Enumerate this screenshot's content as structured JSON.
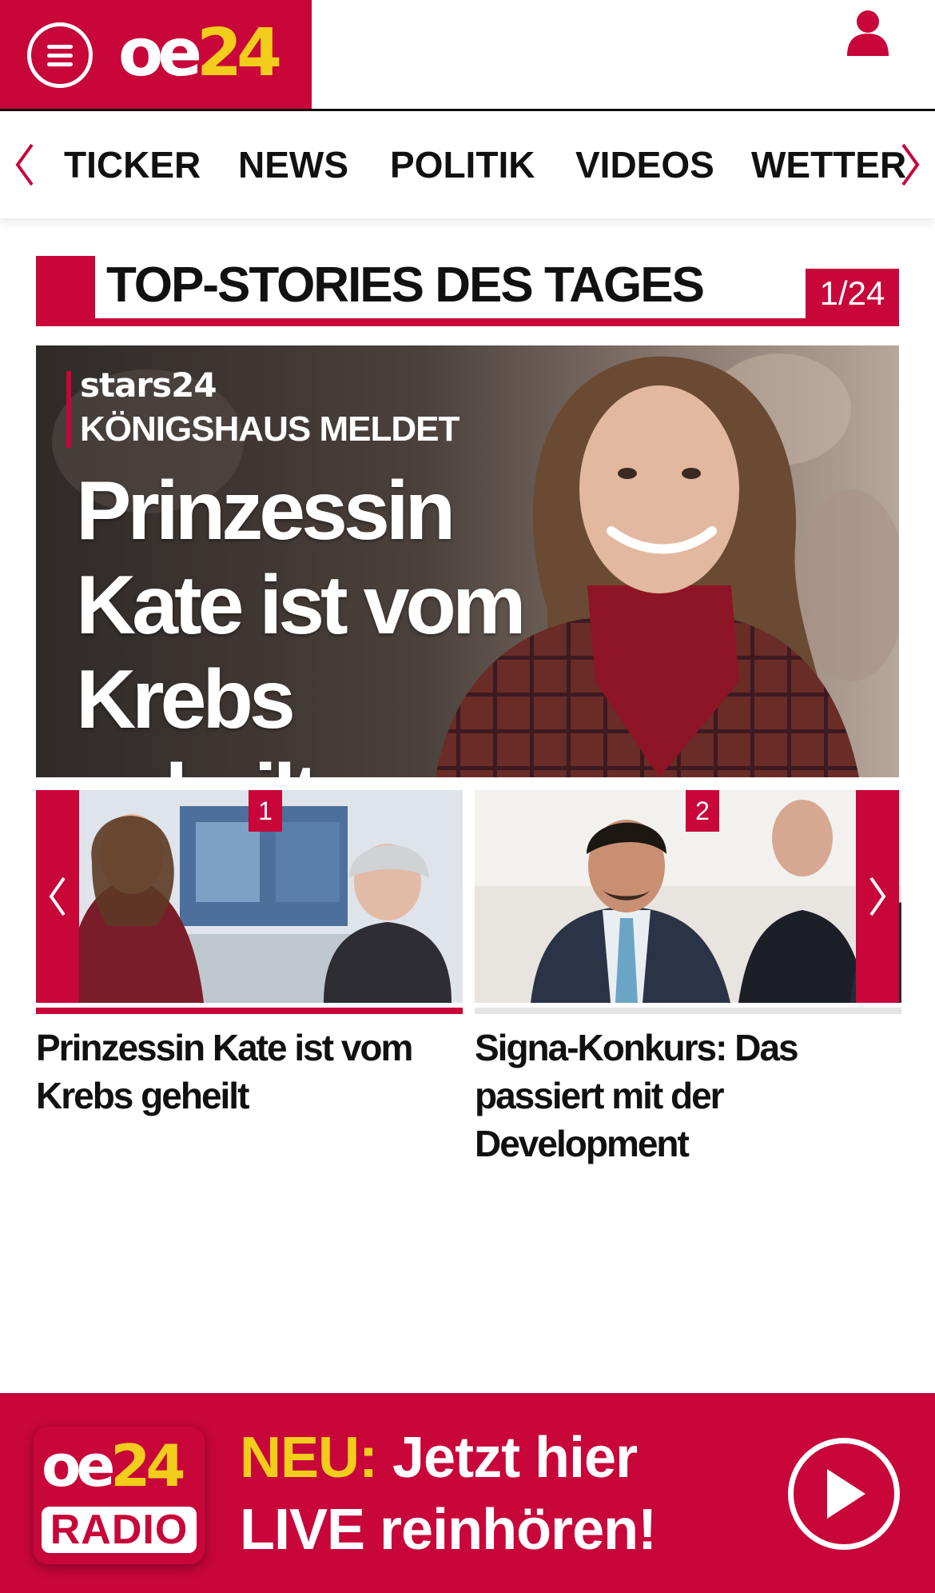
{
  "header": {
    "logo_oe": "oe",
    "logo_24": "24",
    "menu_icon": "hamburger-menu-icon",
    "user_icon": "user-icon"
  },
  "nav": {
    "items": [
      "TICKER",
      "NEWS",
      "POLITIK",
      "VIDEOS",
      "WETTER"
    ],
    "prev_icon": "chevron-left-icon",
    "next_icon": "chevron-right-icon"
  },
  "section": {
    "title": "TOP-STORIES DES TAGES",
    "counter": "1/24"
  },
  "hero": {
    "brand": "stars24",
    "kicker": "KÖNIGSHAUS MELDET",
    "headline": "Prinzessin Kate ist vom Krebs geheilt"
  },
  "cards": [
    {
      "number": "1",
      "title": "Prinzessin Kate ist vom Krebs geheilt"
    },
    {
      "number": "2",
      "title": "Signa-Konkurs: Das passiert mit der Development"
    }
  ],
  "radio": {
    "logo_oe": "oe",
    "logo_24": "24",
    "logo_label": "RADIO",
    "neu": "NEU:",
    "line1": "Jetzt hier",
    "line2": "LIVE reinhören!",
    "play_icon": "play-icon"
  },
  "colors": {
    "brand_red": "#c8063a",
    "logo_yellow": "#f2cd1b"
  }
}
